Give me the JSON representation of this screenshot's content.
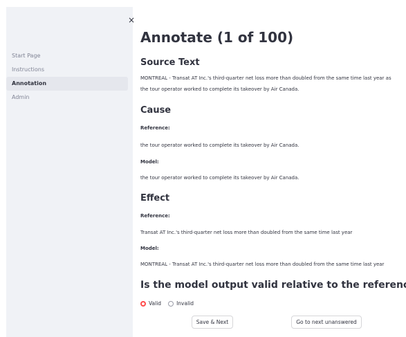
{
  "sidebar": {
    "close_icon": "×",
    "items": [
      {
        "label": "Start Page",
        "active": false
      },
      {
        "label": "Instructions",
        "active": false
      },
      {
        "label": "Annotation",
        "active": true
      },
      {
        "label": "Admin",
        "active": false
      }
    ]
  },
  "main": {
    "title": "Annotate (1 of 100)",
    "source": {
      "heading": "Source Text",
      "line1": "MONTREAL - Transat AT Inc.'s third-quarter net loss more than doubled from the same time last year as",
      "line2": "the tour operator worked to complete its takeover by Air Canada."
    },
    "cause": {
      "heading": "Cause",
      "reference_label": "Reference:",
      "reference_text": "the tour operator worked to complete its takeover by Air Canada.",
      "model_label": "Model:",
      "model_text": "the tour operator worked to complete its takeover by Air Canada."
    },
    "effect": {
      "heading": "Effect",
      "reference_label": "Reference:",
      "reference_text": "Transat AT Inc.'s third-quarter net loss more than doubled from the same time last year",
      "model_label": "Model:",
      "model_text": "MONTREAL - Transat AT Inc.'s third-quarter net loss more than doubled from the same time last year"
    },
    "question": "Is the model output valid relative to the reference?",
    "options": [
      {
        "label": "Valid",
        "selected": true
      },
      {
        "label": "Invalid",
        "selected": false
      }
    ],
    "buttons": {
      "save_next": "Save & Next",
      "go_next_unanswered": "Go to next unanswered"
    }
  },
  "colors": {
    "accent": "#ff4b4b",
    "sidebar_bg": "#f0f2f6",
    "text": "#31333f"
  }
}
